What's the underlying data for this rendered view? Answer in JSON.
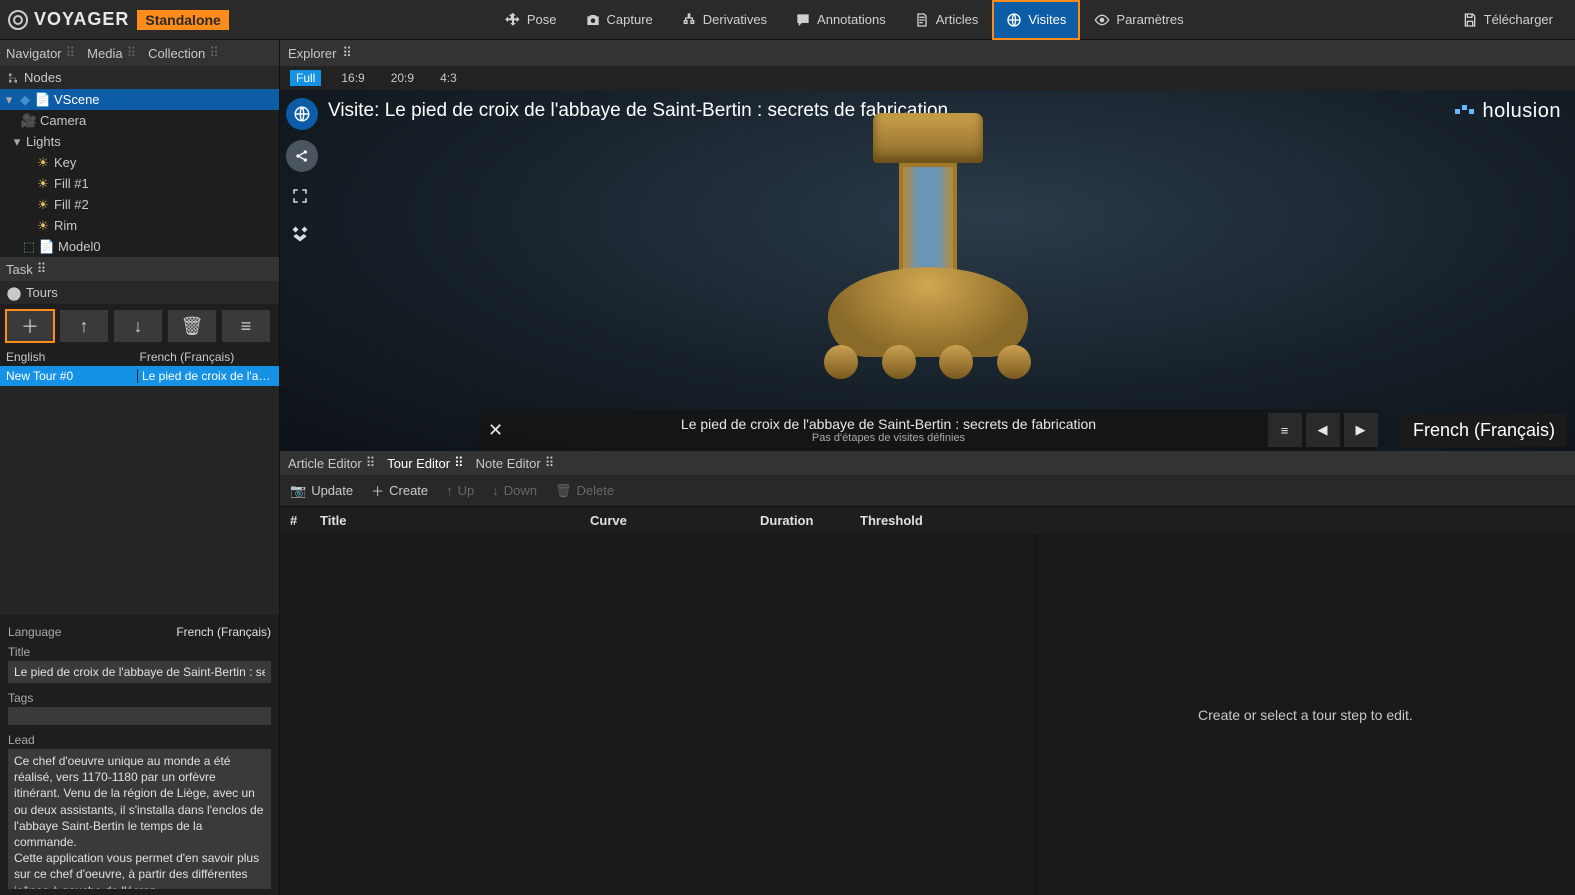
{
  "app": {
    "name": "VOYAGER",
    "badge": "Standalone"
  },
  "top_menu": [
    {
      "id": "pose",
      "label": "Pose"
    },
    {
      "id": "capture",
      "label": "Capture"
    },
    {
      "id": "derivatives",
      "label": "Derivatives"
    },
    {
      "id": "annotations",
      "label": "Annotations"
    },
    {
      "id": "articles",
      "label": "Articles"
    },
    {
      "id": "visites",
      "label": "Visites"
    },
    {
      "id": "parametres",
      "label": "Paramètres"
    }
  ],
  "top_active": "visites",
  "top_right": {
    "download": "Télécharger"
  },
  "left_tabs": {
    "navigator": "Navigator",
    "media": "Media",
    "collection": "Collection"
  },
  "nodes": {
    "header": "Nodes",
    "tree": {
      "scene": "VScene",
      "camera": "Camera",
      "lights_group": "Lights",
      "lights": [
        "Key",
        "Fill #1",
        "Fill #2",
        "Rim"
      ],
      "model": "Model0"
    }
  },
  "task": {
    "header": "Task",
    "tours": "Tours"
  },
  "tour_table": {
    "cols": {
      "en": "English",
      "fr": "French (Français)"
    },
    "row": {
      "en": "New Tour #0",
      "fr": "Le pied de croix de l'a…"
    }
  },
  "props": {
    "language_label": "Language",
    "language_value": "French (Français)",
    "title_label": "Title",
    "title_value": "Le pied de croix de l'abbaye de Saint-Bertin : se",
    "tags_label": "Tags",
    "lead_label": "Lead",
    "lead_value": "Ce chef d'oeuvre unique au monde a été réalisé, vers 1170-1180 par un orfèvre itinérant. Venu de la région de Liège, avec un ou deux assistants, il s'installa dans l'enclos de l'abbaye Saint-Bertin le temps de la commande.\nCette application vous permet d'en savoir plus sur ce chef d'oeuvre, à partir des différentes icônes à gauche de l'écran."
  },
  "explorer": {
    "header": "Explorer",
    "aspects": [
      "Full",
      "16:9",
      "20:9",
      "4:3"
    ],
    "aspect_sel": "Full"
  },
  "viewport": {
    "title_prefix": "Visite: ",
    "title": "Le pied de croix de l'abbaye de Saint-Bertin : secrets de fabrication",
    "brand": "holusion"
  },
  "tour_strip": {
    "title": "Le pied de croix de l'abbaye de Saint-Bertin : secrets de fabrication",
    "sub": "Pas d'étapes de visites définies",
    "lang": "French (Français)"
  },
  "editor_tabs": {
    "article": "Article Editor",
    "tour": "Tour Editor",
    "note": "Note Editor"
  },
  "editor_toolbar": {
    "update": "Update",
    "create": "Create",
    "up": "Up",
    "down": "Down",
    "delete": "Delete"
  },
  "step_head": {
    "num": "#",
    "title": "Title",
    "curve": "Curve",
    "duration": "Duration",
    "threshold": "Threshold"
  },
  "step_empty": "Create or select a tour step to edit."
}
